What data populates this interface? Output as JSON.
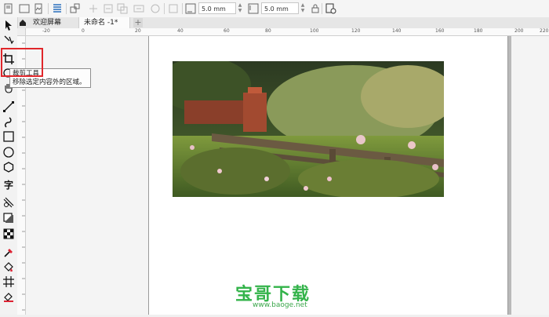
{
  "property_bar": {
    "width_value": "5.0 mm",
    "height_value": "5.0 mm"
  },
  "tabs": [
    {
      "label": "欢迎屏幕",
      "active": false
    },
    {
      "label": "未命名 -1*",
      "active": true
    }
  ],
  "tabbar": {
    "add_tab_symbol": "+"
  },
  "ruler": {
    "labels": [
      "-20",
      "0",
      "20",
      "40",
      "60",
      "80",
      "100",
      "120",
      "140",
      "160",
      "180",
      "200",
      "220"
    ]
  },
  "toolbox": {
    "items": [
      {
        "name": "pick-tool-icon",
        "selected": false
      },
      {
        "name": "shape-tool-icon",
        "selected": false
      },
      {
        "name": "crop-tool-icon",
        "selected": true
      },
      {
        "name": "zoom-tool-icon",
        "selected": false
      },
      {
        "name": "pan-tool-icon",
        "selected": false
      },
      {
        "name": "freehand-tool-icon",
        "selected": false
      },
      {
        "name": "artistic-media-icon",
        "selected": false
      },
      {
        "name": "rectangle-tool-icon",
        "selected": false
      },
      {
        "name": "ellipse-tool-icon",
        "selected": false
      },
      {
        "name": "polygon-tool-icon",
        "selected": false
      },
      {
        "name": "text-tool-icon",
        "selected": false
      },
      {
        "name": "parallel-dimension-icon",
        "selected": false
      },
      {
        "name": "connector-tool-icon",
        "selected": false
      },
      {
        "name": "drop-shadow-icon",
        "selected": false
      },
      {
        "name": "transparency-icon",
        "selected": false
      },
      {
        "name": "eyedropper-icon",
        "selected": false
      },
      {
        "name": "interactive-fill-icon",
        "selected": false
      },
      {
        "name": "mesh-fill-icon",
        "selected": false
      },
      {
        "name": "smart-fill-icon",
        "selected": false
      }
    ],
    "text_tool_glyph": "字"
  },
  "tooltip": {
    "title": "裁剪工具",
    "description": "移除选定内容外的区域。"
  },
  "watermark": {
    "title": "宝哥下载",
    "url": "www.baoge.net"
  },
  "colors": {
    "highlight": "#e0262a",
    "watermark_green": "#33b34a",
    "accent_blue": "#2a6ebd"
  }
}
